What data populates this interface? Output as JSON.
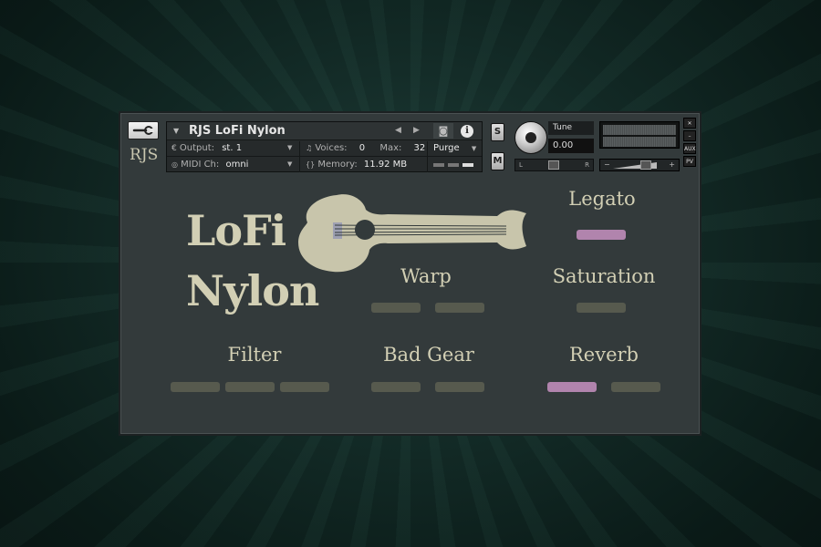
{
  "instrument": {
    "logo_text": "RJS",
    "name": "RJS LoFi Nylon",
    "output_label": "Output:",
    "output_value": "st. 1",
    "midi_label": "MIDI Ch:",
    "midi_value": "omni",
    "voices_label": "Voices:",
    "voices_value": "0",
    "max_label": "Max:",
    "max_value": "32",
    "memory_label": "Memory:",
    "memory_value": "11.92 MB",
    "purge_label": "Purge",
    "solo_label": "S",
    "mute_label": "M",
    "tune_label": "Tune",
    "tune_value": "0.00",
    "pan_left": "L",
    "pan_right": "R",
    "vol_minus": "−",
    "vol_plus": "+",
    "aux_label": "AUX",
    "pv_label": "PV"
  },
  "ui": {
    "title_line1": "LoFi",
    "title_line2": "Nylon",
    "legato_label": "Legato",
    "warp_label": "Warp",
    "saturation_label": "Saturation",
    "filter_label": "Filter",
    "bad_gear_label": "Bad Gear",
    "reverb_label": "Reverb"
  },
  "switches": {
    "legato": [
      true
    ],
    "warp": [
      false,
      false
    ],
    "saturation": [
      false
    ],
    "filter": [
      false,
      false,
      false
    ],
    "bad_gear": [
      false,
      false
    ],
    "reverb": [
      true,
      false
    ]
  },
  "colors": {
    "panel": "#333a3b",
    "text": "#d2cfb4",
    "switch_off": "#575a4e",
    "switch_on": "#b184ad"
  }
}
